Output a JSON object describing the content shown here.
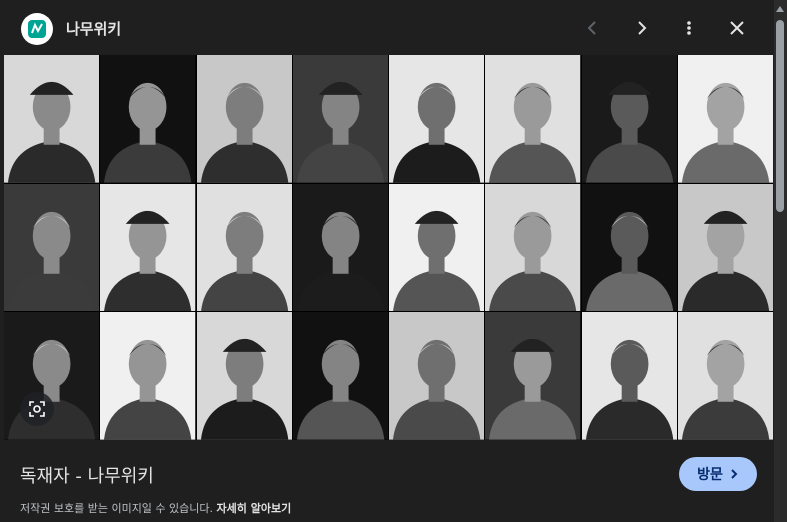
{
  "header": {
    "site_name": "나무위키",
    "logo_icon": "namuwiki-logo-icon",
    "prev_icon": "chevron-left-icon",
    "next_icon": "chevron-right-icon",
    "more_icon": "more-vert-icon",
    "close_icon": "close-icon"
  },
  "image": {
    "grid_rows": 3,
    "grid_cols": 8,
    "lens_icon": "lens-icon"
  },
  "caption": {
    "title": "독재자 - 나무위키",
    "visit_label": "방문",
    "copyright_text": "저작권 보호를 받는 이미지일 수 있습니다.",
    "learn_more": "자세히 알아보기"
  },
  "colors": {
    "background": "#1f1f1f",
    "accent": "#a8c7fa",
    "accent_text": "#062e6f",
    "logo_green": "#00a495"
  }
}
